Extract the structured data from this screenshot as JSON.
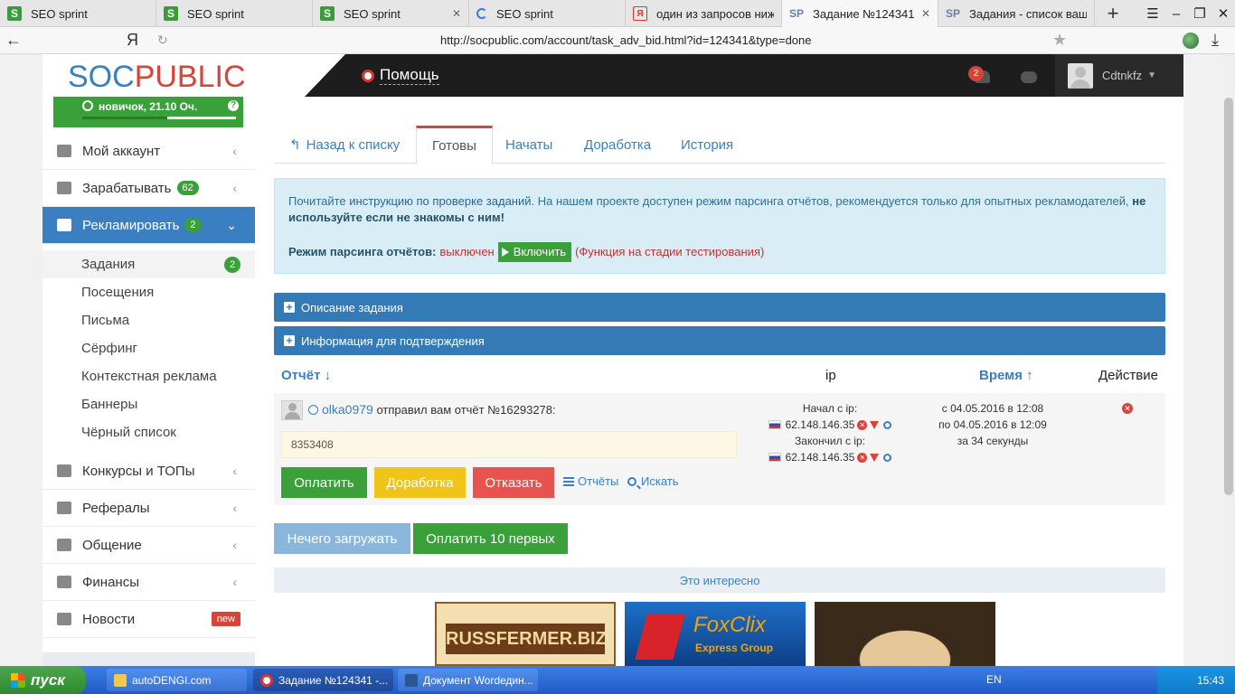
{
  "browser": {
    "tabs": [
      {
        "title": "SEO sprint",
        "icon": "seosprint-favicon",
        "active": false
      },
      {
        "title": "SEO sprint",
        "icon": "seosprint-favicon",
        "active": false
      },
      {
        "title": "SEO sprint",
        "icon": "seosprint-favicon",
        "active": false
      },
      {
        "title": "SEO sprint",
        "icon": "loading-spinner",
        "active": false
      },
      {
        "title": "один из запросов ниже",
        "icon": "yandex-favicon",
        "active": false
      },
      {
        "title": "Задание №124341 -",
        "icon": "socpublic-favicon",
        "active": true
      },
      {
        "title": "Задания - список ваших",
        "icon": "socpublic-favicon",
        "active": false
      }
    ],
    "search_logo": "Я",
    "url": "http://socpublic.com/account/task_adv_bid.html?id=124341&type=done"
  },
  "header": {
    "logo_part1": "SOC",
    "logo_part2": "PUBLIC",
    "help_label": "Помощь",
    "notifications_count": "2",
    "username": "Cdtnkfz"
  },
  "sidebar": {
    "rank_label": "новичок, 21.10 Оч.",
    "rank_progress": 0.55,
    "items": [
      {
        "label": "Мой аккаунт",
        "icon": "home-icon"
      },
      {
        "label": "Зарабатывать",
        "icon": "briefcase-icon",
        "badge": "62"
      },
      {
        "label": "Рекламировать",
        "icon": "chart-icon",
        "badge": "2"
      },
      {
        "label": "Конкурсы и ТОПы",
        "icon": "trophy-icon"
      },
      {
        "label": "Рефералы",
        "icon": "users-icon"
      },
      {
        "label": "Общение",
        "icon": "comments-icon"
      },
      {
        "label": "Финансы",
        "icon": "ruble-icon"
      },
      {
        "label": "Новости",
        "icon": "bullhorn-icon",
        "tag": "new"
      }
    ],
    "sub_items": [
      {
        "label": "Задания",
        "badge": "2"
      },
      {
        "label": "Посещения"
      },
      {
        "label": "Письма"
      },
      {
        "label": "Сёрфинг"
      },
      {
        "label": "Контекстная реклама"
      },
      {
        "label": "Баннеры"
      },
      {
        "label": "Чёрный список"
      }
    ]
  },
  "main": {
    "tabs": [
      {
        "label": "Назад к списку"
      },
      {
        "label": "Готовы"
      },
      {
        "label": "Начаты"
      },
      {
        "label": "Доработка"
      },
      {
        "label": "История"
      }
    ],
    "alert": {
      "text1": "Почитайте ",
      "link": "инструкцию по проверке заданий",
      "text2": ". На нашем проекте доступен режим парсинга отчётов, рекомендуется только для опытных рекламодателей, ",
      "bold": "не используйте если не знакомы с ним!",
      "mode_label": "Режим парсинга отчётов:",
      "mode_state": "выключен",
      "enable_button": "Включить",
      "testing_note": "(Функция на стадии тестирования)"
    },
    "panels": [
      {
        "label": "Описание задания"
      },
      {
        "label": "Информация для подтверждения"
      }
    ],
    "table": {
      "headers": {
        "report": "Отчёт",
        "ip": "ip",
        "time": "Время",
        "action": "Действие"
      },
      "rows": [
        {
          "username": "olka0979",
          "sent_text": "отправил вам отчёт №16293278:",
          "answer": "8353408",
          "start_label": "Начал с ip:",
          "start_ip": "62.148.146.35",
          "end_label": "Закончил с ip:",
          "end_ip": "62.148.146.35",
          "time_from": "с 04.05.2016 в 12:08",
          "time_to": "по 04.05.2016 в 12:09",
          "duration": "за 34 секунды",
          "btn_pay": "Оплатить",
          "btn_rework": "Доработка",
          "btn_reject": "Отказать",
          "link_reports": "Отчёты",
          "link_search": "Искать"
        }
      ]
    },
    "btn_nothing": "Нечего загружать",
    "btn_pay10": "Оплатить 10 первых",
    "interesting": "Это интересно",
    "banners": [
      {
        "text": "RUSSFERMER.BIZ"
      },
      {
        "text": "FoxClix",
        "sub": "Express Group"
      },
      {
        "text": ""
      }
    ]
  },
  "taskbar": {
    "start": "пуск",
    "tasks": [
      {
        "label": "autoDENGI.com",
        "icon": "folder-icon"
      },
      {
        "label": "Задание №124341 -...",
        "icon": "yandex-browser-icon"
      },
      {
        "label": "Документ Wordедин...",
        "icon": "word-icon"
      }
    ],
    "lang": "EN",
    "clock": "15:43"
  }
}
